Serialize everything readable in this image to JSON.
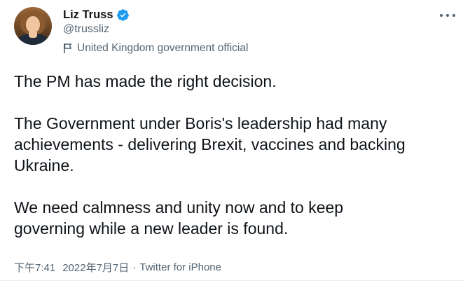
{
  "author": {
    "display_name": "Liz Truss",
    "handle": "@trussliz",
    "verified_icon": "verified-badge-icon",
    "affiliation_icon": "flag-icon",
    "affiliation": "United Kingdom government official"
  },
  "tweet": {
    "paragraphs": [
      [
        "The PM has made the right decision."
      ],
      [
        "The Government under Boris's leadership had many",
        "achievements - delivering Brexit, vaccines and backing",
        "Ukraine."
      ],
      [
        "We need calmness and unity now and to keep",
        "governing while a new leader is found."
      ]
    ]
  },
  "meta": {
    "time": "下午7:41",
    "separator": "·",
    "date": "2022年7月7日",
    "source": "Twitter for iPhone"
  },
  "more_icon": "more-horizontal-icon",
  "colors": {
    "text": "#0f1419",
    "secondary": "#536471",
    "verified": "#1d9bf0"
  }
}
